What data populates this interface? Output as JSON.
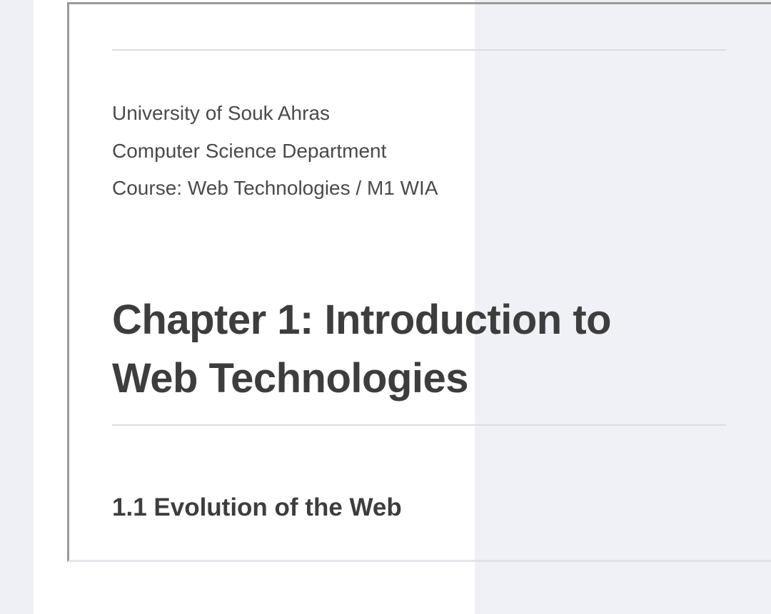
{
  "document": {
    "header_lines": [
      "University of Souk Ahras",
      "Computer Science Department",
      "Course: Web Technologies / M1 WIA"
    ],
    "chapter_title_lines": [
      "Chapter 1: Introduction to",
      "Web Technologies"
    ],
    "section_heading": "1.1 Evolution of the Web"
  },
  "colors": {
    "page_background": "#ffffff",
    "outer_background": "#f1f3f7",
    "text": "#3d3d3d",
    "rule": "#dcdde0"
  }
}
